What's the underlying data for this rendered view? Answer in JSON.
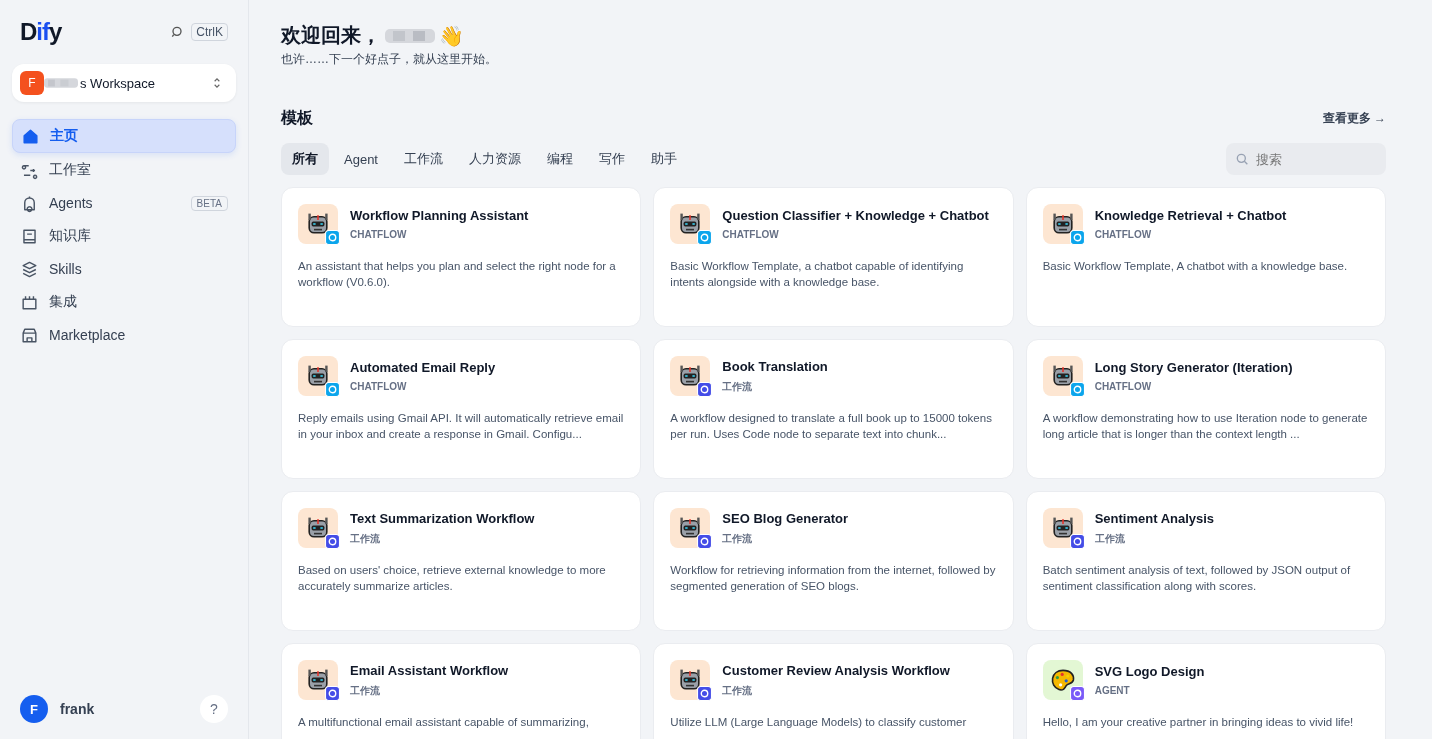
{
  "sidebar": {
    "logo": {
      "part1": "D",
      "part2": "if",
      "part3": "y"
    },
    "shortcut": "CtrlK",
    "workspace": {
      "initial": "F",
      "name": "s Workspace"
    },
    "items": [
      {
        "label": "主页",
        "selected": true
      },
      {
        "label": "工作室",
        "selected": false
      },
      {
        "label": "Agents",
        "selected": false,
        "badge": "BETA"
      },
      {
        "label": "知识库",
        "selected": false
      },
      {
        "label": "Skills",
        "selected": false
      },
      {
        "label": "集成",
        "selected": false
      },
      {
        "label": "Marketplace",
        "selected": false
      }
    ],
    "user": {
      "initial": "F",
      "name": "frank"
    },
    "help": "?"
  },
  "header": {
    "greeting": "欢迎回来，",
    "wave": "👋",
    "subtitle": "也许……下一个好点子，就从这里开始。"
  },
  "templates": {
    "title": "模板",
    "more": "查看更多 →",
    "search": {
      "placeholder": "搜索"
    },
    "tabs": [
      {
        "label": "所有",
        "selected": true
      },
      {
        "label": "Agent",
        "selected": false
      },
      {
        "label": "工作流",
        "selected": false
      },
      {
        "label": "人力资源",
        "selected": false
      },
      {
        "label": "编程",
        "selected": false
      },
      {
        "label": "写作",
        "selected": false
      },
      {
        "label": "助手",
        "selected": false
      }
    ],
    "cards": [
      {
        "title": "Workflow Planning Assistant",
        "kind": "chatflow",
        "type_label": "CHATFLOW",
        "description": "An assistant that helps you plan and select the right node for a workflow (V0.6.0)."
      },
      {
        "title": "Question Classifier + Knowledge + Chatbot",
        "kind": "chatflow",
        "type_label": "CHATFLOW",
        "description": "Basic Workflow Template, a chatbot capable of identifying intents alongside with a knowledge base."
      },
      {
        "title": "Knowledge Retrieval + Chatbot",
        "kind": "chatflow",
        "type_label": "CHATFLOW",
        "description": "Basic Workflow Template, A chatbot with a knowledge base."
      },
      {
        "title": "Automated Email Reply",
        "kind": "chatflow",
        "type_label": "CHATFLOW",
        "description": "Reply emails using Gmail API. It will automatically retrieve email in your inbox and create a response in Gmail. Configu..."
      },
      {
        "title": "Book Translation",
        "kind": "workflow",
        "type_label": "工作流",
        "description": "A workflow designed to translate a full book up to 15000 tokens per run. Uses Code node to separate text into chunk..."
      },
      {
        "title": "Long Story Generator (Iteration)",
        "kind": "chatflow",
        "type_label": "CHATFLOW",
        "description": "A workflow demonstrating how to use Iteration node to generate long article that is longer than the context length ..."
      },
      {
        "title": "Text Summarization Workflow",
        "kind": "workflow",
        "type_label": "工作流",
        "description": "Based on users' choice, retrieve external knowledge to more accurately summarize articles."
      },
      {
        "title": "SEO Blog Generator",
        "kind": "workflow",
        "type_label": "工作流",
        "description": "Workflow for retrieving information from the internet, followed by segmented generation of SEO blogs."
      },
      {
        "title": "Sentiment Analysis",
        "kind": "workflow",
        "type_label": "工作流",
        "description": "Batch sentiment analysis of text, followed by JSON output of sentiment classification along with scores."
      },
      {
        "title": "Email Assistant Workflow",
        "kind": "workflow",
        "type_label": "工作流",
        "description": "A multifunctional email assistant capable of summarizing,"
      },
      {
        "title": "Customer Review Analysis Workflow",
        "kind": "workflow",
        "type_label": "工作流",
        "description": "Utilize LLM (Large Language Models) to classify customer"
      },
      {
        "title": "SVG Logo Design",
        "kind": "agent",
        "type_label": "AGENT",
        "description": "Hello, I am your creative partner in bringing ideas to vivid life!"
      }
    ]
  }
}
